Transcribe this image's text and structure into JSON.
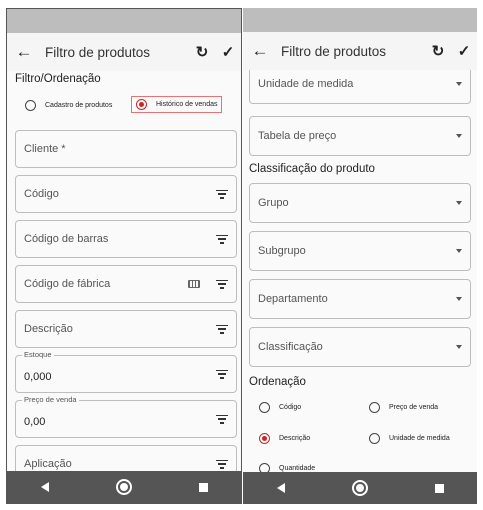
{
  "left": {
    "title": "Filtro de produtos",
    "section_filter": "Filtro/Ordenação",
    "radio_cadastro": "Cadastro de produtos",
    "radio_historico": "Histórico de vendas",
    "cliente": "Cliente *",
    "codigo": "Código",
    "codigo_barras": "Código de barras",
    "codigo_fabrica": "Código de fábrica",
    "descricao": "Descrição",
    "estoque_label": "Estoque",
    "estoque_value": "0,000",
    "preco_label": "Preço de venda",
    "preco_value": "0,00",
    "aplicacao": "Aplicação"
  },
  "right": {
    "title": "Filtro de produtos",
    "unidade_medida": "Unidade de medida",
    "tabela_preco": "Tabela de preço",
    "section_classificacao": "Classificação do produto",
    "grupo": "Grupo",
    "subgrupo": "Subgrupo",
    "departamento": "Departamento",
    "classificacao": "Classificação",
    "section_ordenacao": "Ordenação",
    "ord_codigo": "Código",
    "ord_preco_venda": "Preço de venda",
    "ord_descricao": "Descrição",
    "ord_unidade_medida": "Unidade de medida",
    "ord_quantidade": "Quantidade"
  },
  "colors": {
    "accent": "#c62828",
    "navbar": "#555555",
    "statusbar": "#bdbdbd"
  }
}
